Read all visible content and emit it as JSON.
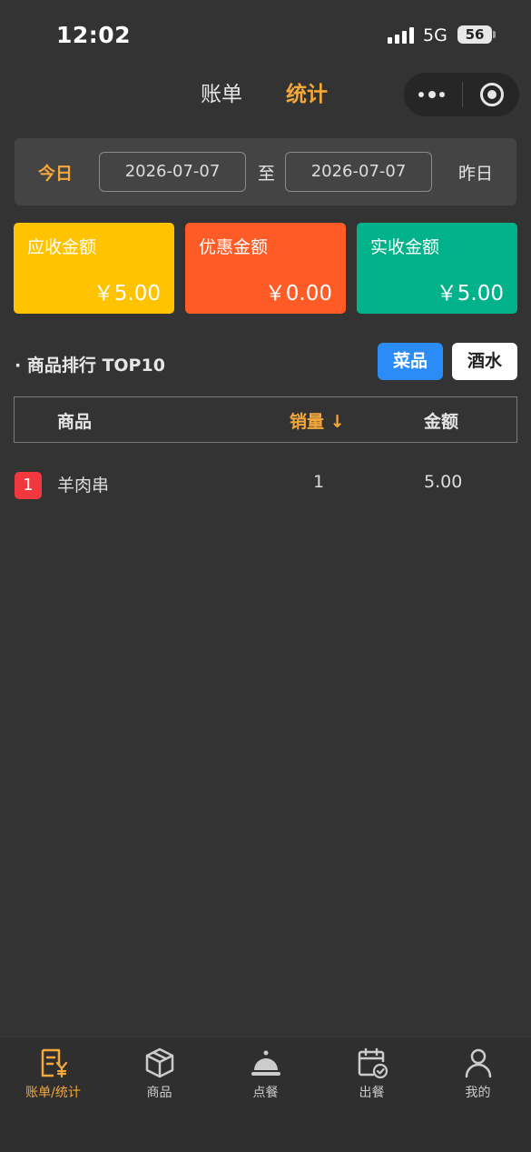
{
  "status_bar": {
    "time": "12:02",
    "network": "5G",
    "battery": "56"
  },
  "header": {
    "tabs": [
      "账单",
      "统计"
    ],
    "active_tab": "统计"
  },
  "date_filter": {
    "today_label": "今日",
    "start_date": "2026-07-07",
    "separator": "至",
    "end_date": "2026-07-07",
    "yesterday_label": "昨日"
  },
  "summary_cards": [
    {
      "label": "应收金额",
      "value": "￥5.00",
      "color": "#ffc300"
    },
    {
      "label": "优惠金额",
      "value": "￥0.00",
      "color": "#ff5b27"
    },
    {
      "label": "实收金额",
      "value": "￥5.00",
      "color": "#02b28a"
    }
  ],
  "ranking": {
    "title": "· 商品排行 TOP10",
    "filters": [
      {
        "label": "菜品",
        "active": true
      },
      {
        "label": "酒水",
        "active": false
      }
    ],
    "columns": [
      "商品",
      "销量 ↓",
      "金额"
    ],
    "rows": [
      {
        "rank": "1",
        "name": "羊肉串",
        "quantity": "1",
        "amount": "5.00"
      }
    ]
  },
  "tab_bar": {
    "items": [
      {
        "label": "账单/统计",
        "icon": "bill-yen-icon",
        "active": true
      },
      {
        "label": "商品",
        "icon": "box-icon",
        "active": false
      },
      {
        "label": "点餐",
        "icon": "service-bell-icon",
        "active": false
      },
      {
        "label": "出餐",
        "icon": "calendar-check-icon",
        "active": false
      },
      {
        "label": "我的",
        "icon": "user-icon",
        "active": false
      }
    ]
  },
  "colors": {
    "accent": "#f5a83a",
    "primary_button": "#2b8cf7",
    "rank_badge": "#f0383e",
    "background": "#333333"
  }
}
